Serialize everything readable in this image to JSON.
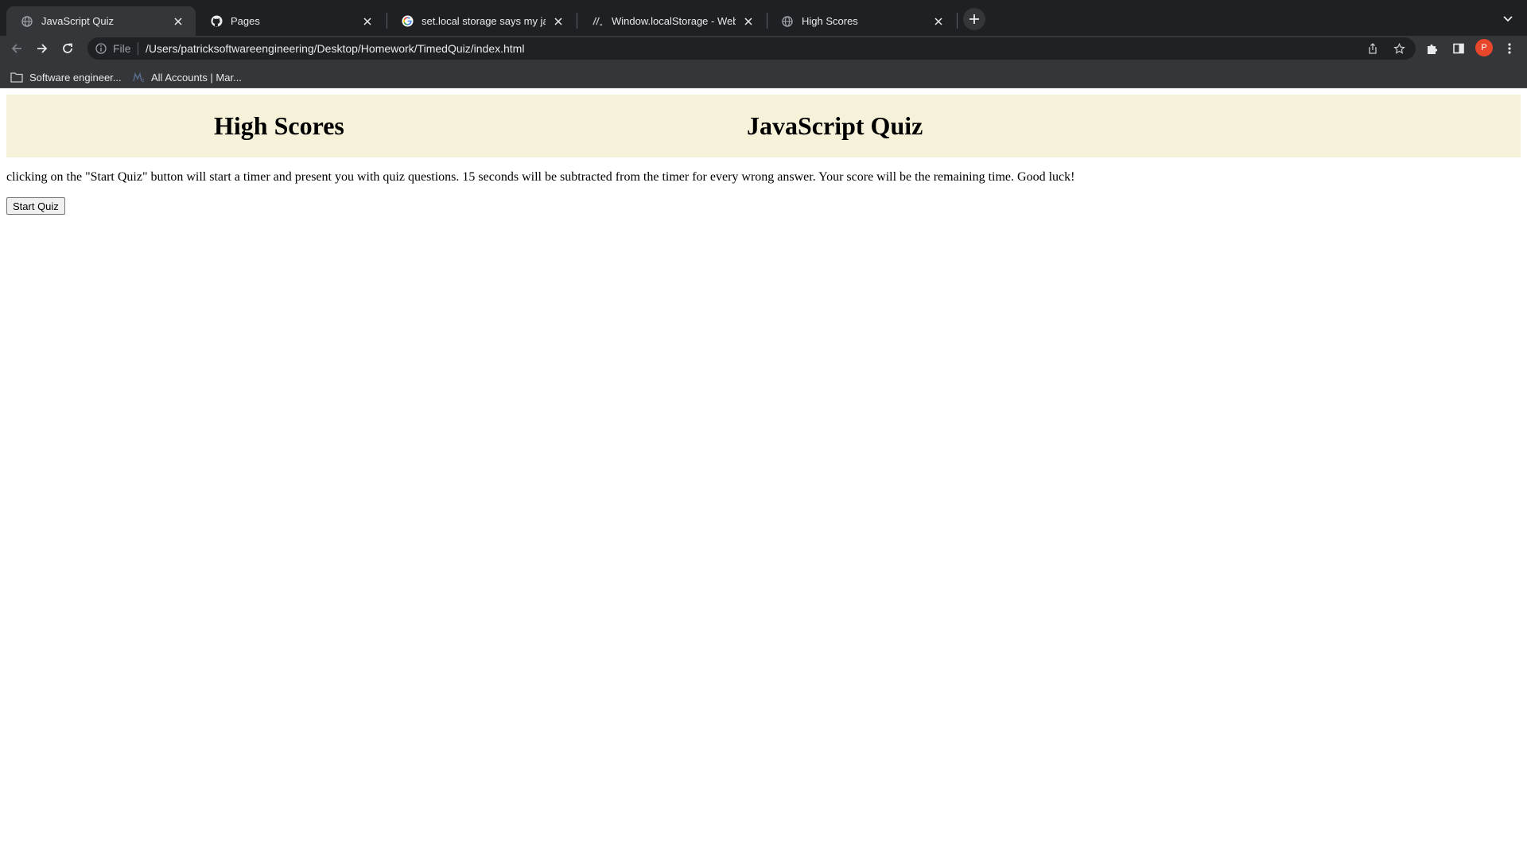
{
  "browser": {
    "tabs": [
      {
        "title": "JavaScript Quiz",
        "icon": "globe-icon",
        "active": true
      },
      {
        "title": "Pages",
        "icon": "github-icon",
        "active": false
      },
      {
        "title": "set.local storage says my javas",
        "icon": "google-icon",
        "active": false
      },
      {
        "title": "Window.localStorage - Web AP",
        "icon": "mdn-icon",
        "active": false
      },
      {
        "title": "High Scores",
        "icon": "globe-icon",
        "active": false
      }
    ],
    "address_bar": {
      "scheme_label": "File",
      "url": "/Users/patricksoftwareengineering/Desktop/Homework/TimedQuiz/index.html"
    },
    "bookmarks": [
      {
        "label": "Software engineer...",
        "icon": "folder-icon"
      },
      {
        "label": "All Accounts | Mar...",
        "icon": "bank-icon"
      }
    ],
    "profile_initial": "P",
    "colors": {
      "tabstrip": "#1f2023",
      "toolbar": "#35363a",
      "omnibox": "#202124",
      "avatar": "#e8472b"
    }
  },
  "page": {
    "header": {
      "high_scores_link": "High Scores",
      "title": "JavaScript Quiz",
      "background": "#f5f2d9"
    },
    "intro_text": "clicking on the \"Start Quiz\" button will start a timer and present you with quiz questions. 15 seconds will be subtracted from the timer for every wrong answer. Your score will be the remaining time. Good luck!",
    "start_button_label": "Start Quiz"
  }
}
